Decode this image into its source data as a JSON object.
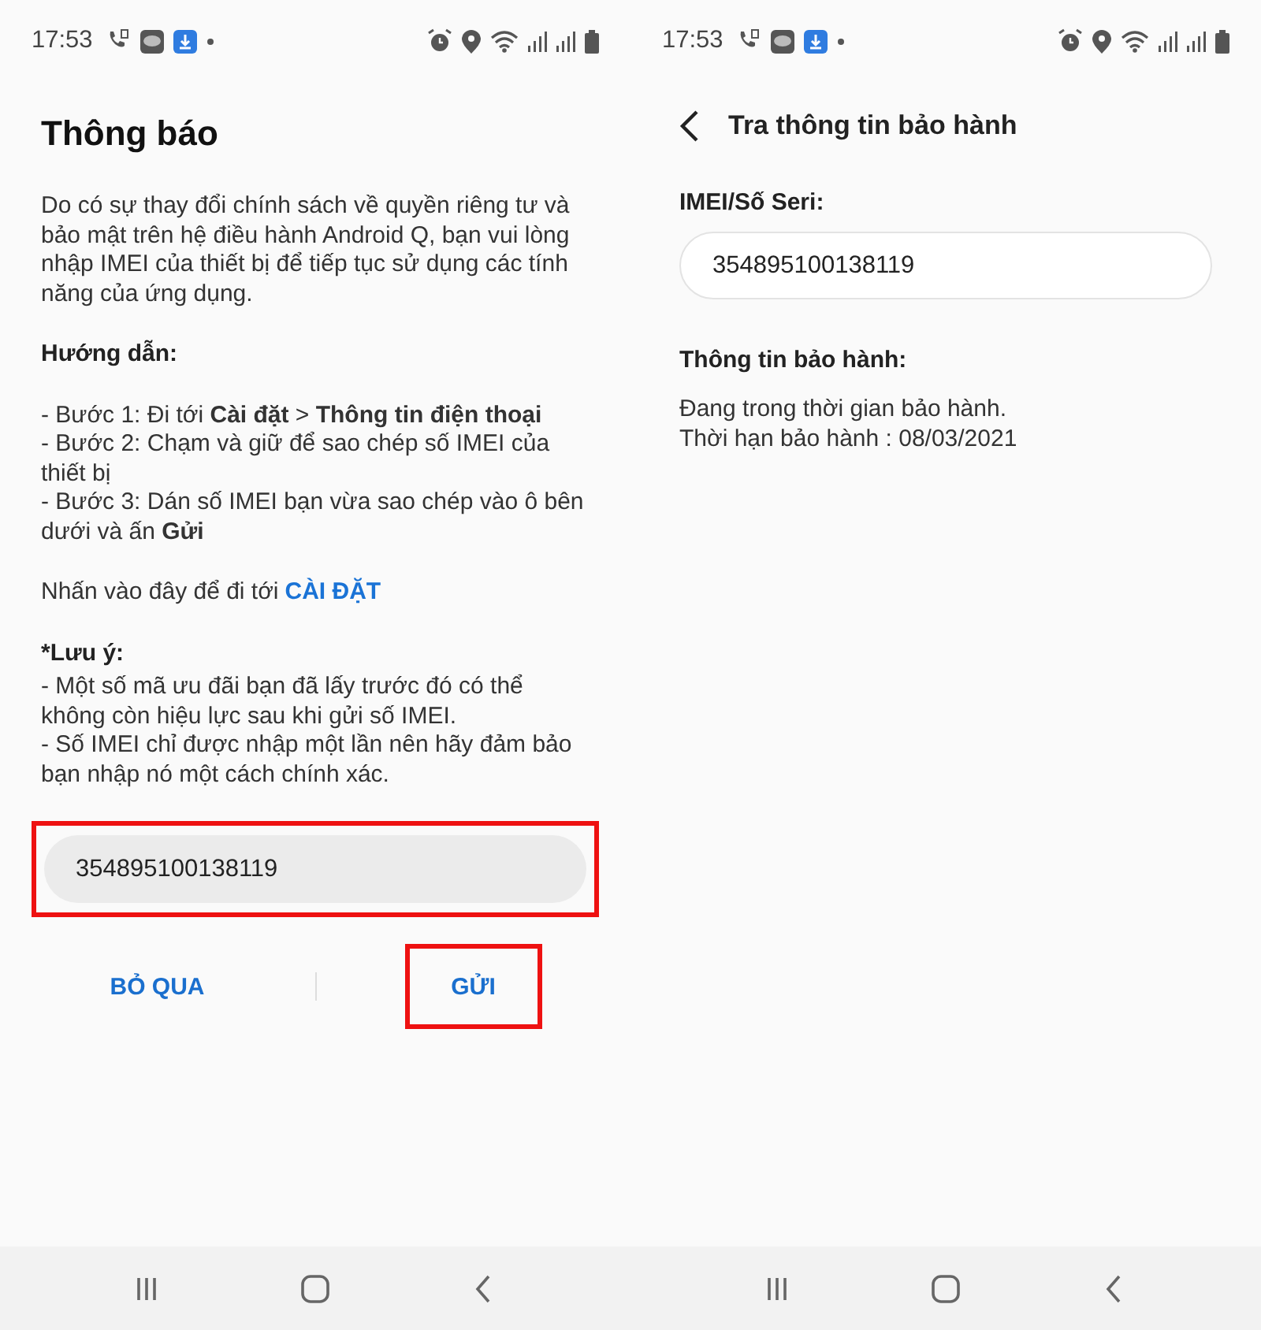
{
  "screens": [
    {
      "kind": "notice",
      "status_bar": {
        "time": "17:53"
      },
      "title": "Thông báo",
      "intro": "Do có sự thay đổi chính sách về quyền riêng tư và bảo mật trên hệ điều hành Android Q, bạn vui lòng nhập IMEI của thiết bị để tiếp tục sử dụng các tính năng của ứng dụng.",
      "guide_heading": "Hướng dẫn:",
      "steps": [
        "- Bước 1: Đi tới **Cài đặt** > **Thông tin điện thoại**",
        "- Bước 2: Chạm và giữ để sao chép số IMEI của thiết bị",
        "- Bước 3: Dán số IMEI bạn vừa sao chép vào ô bên dưới và ấn **Gửi**"
      ],
      "settings_prompt": "Nhấn vào đây để đi tới",
      "settings_link": "CÀI ĐẶT",
      "note_heading": "*Lưu ý:",
      "notes": [
        "- Một số mã ưu đãi bạn đã lấy trước đó có thể không còn hiệu lực sau khi gửi số IMEI.",
        "- Số IMEI chỉ được nhập một lần nên hãy đảm bảo bạn nhập nó một cách chính xác."
      ],
      "imei_field": {
        "value": "354895100138119",
        "highlighted": true
      },
      "buttons": [
        {
          "label": "BỎ QUA",
          "highlighted": false
        },
        {
          "label": "GỬI",
          "highlighted": true
        }
      ]
    },
    {
      "kind": "warranty",
      "status_bar": {
        "time": "17:53"
      },
      "title": "Tra thông tin bảo hành",
      "imei_label": "IMEI/Số Seri:",
      "imei_field": {
        "value": "354895100138119",
        "highlighted": false
      },
      "info_heading": "Thông tin bảo hành:",
      "info_lines": [
        "Đang trong thời gian bảo hành.",
        "Thời hạn bảo hành : 08/03/2021"
      ]
    }
  ]
}
